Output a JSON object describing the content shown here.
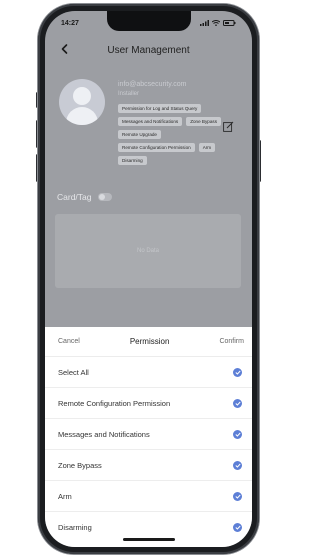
{
  "status_bar": {
    "time": "14:27"
  },
  "nav": {
    "title": "User Management"
  },
  "profile": {
    "email": "info@abcsecurity.com",
    "role": "Installer",
    "permissions": [
      "Permission for Log and Status Query",
      "Messages and Notifications",
      "Zone Bypass",
      "Remote Upgrade",
      "Remote Configuration Permission",
      "Arm",
      "Disarming"
    ]
  },
  "card": {
    "label": "Card/Tag",
    "empty_text": "No Data"
  },
  "sheet": {
    "cancel_label": "Cancel",
    "title": "Permission",
    "confirm_label": "Confirm",
    "options": [
      {
        "label": "Select All",
        "checked": true
      },
      {
        "label": "Remote Configuration Permission",
        "checked": true
      },
      {
        "label": "Messages and Notifications",
        "checked": true
      },
      {
        "label": "Zone Bypass",
        "checked": true
      },
      {
        "label": "Arm",
        "checked": true
      },
      {
        "label": "Disarming",
        "checked": true
      }
    ]
  },
  "colors": {
    "accent": "#5d7fd6",
    "overlay": "#9c9ea3"
  }
}
